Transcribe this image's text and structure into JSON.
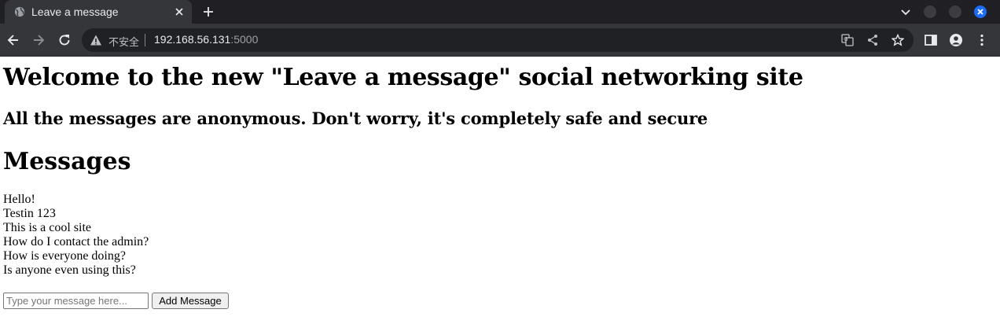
{
  "browser": {
    "tab": {
      "title": "Leave a message",
      "favicon": "globe-icon"
    },
    "address": {
      "security_label": "不安全",
      "host": "192.168.56.131",
      "port": ":5000"
    },
    "colors": {
      "chrome": "#35363a",
      "tabbar": "#1f1f24",
      "close_accent": "#1a6cff"
    }
  },
  "page": {
    "title": "Welcome to the new \"Leave a message\" social networking site",
    "subtitle": "All the messages are anonymous. Don't worry, it's completely safe and secure",
    "messages_heading": "Messages",
    "messages": [
      "Hello!",
      "Testin 123",
      "This is a cool site",
      "How do I contact the admin?",
      "How is everyone doing?",
      "Is anyone even using this?"
    ],
    "form": {
      "placeholder": "Type your message here...",
      "value": "",
      "button_label": "Add Message"
    }
  }
}
